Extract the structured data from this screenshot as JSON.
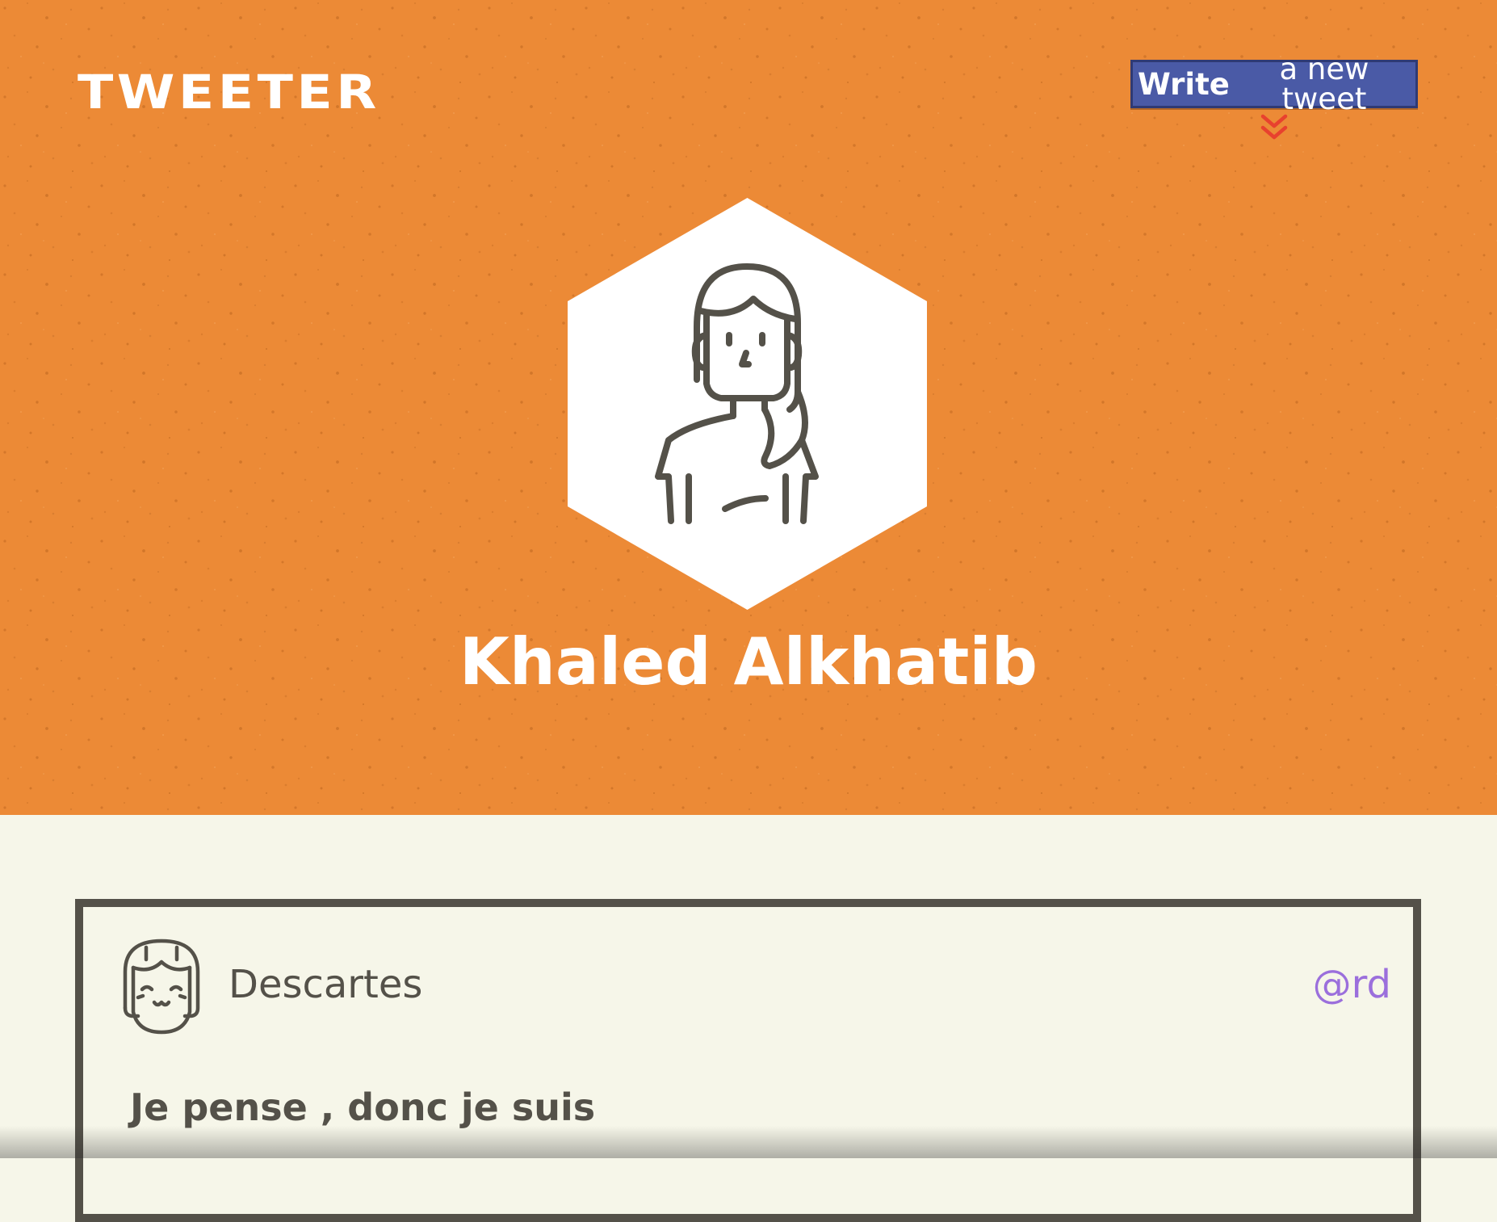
{
  "header": {
    "brand": "TWEETER",
    "compose_bold": "Write",
    "compose_rest": "a new tweet",
    "bg_color": "#ec8a36",
    "compose_color": "#4a5aa6",
    "chevron_color": "#e8412e",
    "chevron_icon": "double-chevron-down-icon"
  },
  "profile": {
    "name": "Khaled Alkhatib",
    "avatar_icon": "woman-avatar-icon"
  },
  "tweet": {
    "author": "Descartes",
    "handle": "@rd",
    "text": "Je pense , donc je suis",
    "avatar_icon": "smiling-girl-avatar-icon",
    "handle_color": "#9b6fdc",
    "border_color": "#545149"
  }
}
